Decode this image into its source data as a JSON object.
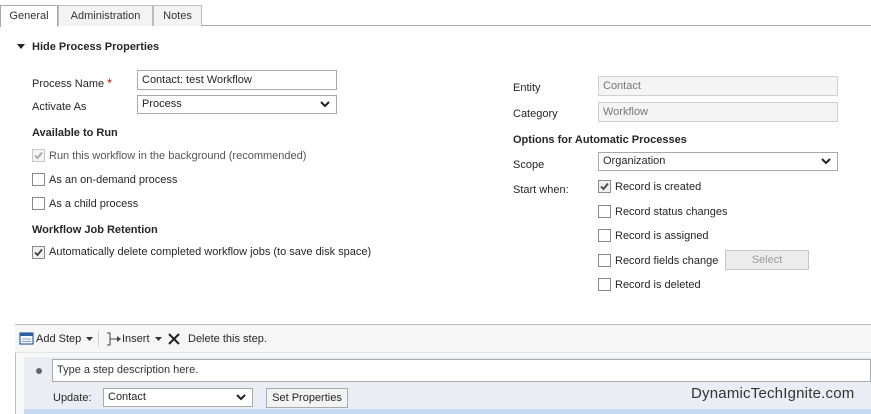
{
  "tabs": [
    {
      "label": "General",
      "active": true
    },
    {
      "label": "Administration",
      "active": false
    },
    {
      "label": "Notes",
      "active": false
    }
  ],
  "section": {
    "title": "Hide Process Properties"
  },
  "left": {
    "process_name_label": "Process Name",
    "required_marker": "*",
    "process_name_value": "Contact: test Workflow",
    "activate_as_label": "Activate As",
    "activate_as_value": "Process",
    "available_to_run_heading": "Available to Run",
    "options": [
      {
        "label": "Run this workflow in the background (recommended)",
        "checked": true,
        "disabled": true
      },
      {
        "label": "As an on-demand process",
        "checked": false,
        "disabled": false
      },
      {
        "label": "As a child process",
        "checked": false,
        "disabled": false
      }
    ],
    "retention_heading": "Workflow Job Retention",
    "retention_option": {
      "label": "Automatically delete completed workflow jobs (to save disk space)",
      "checked": true
    }
  },
  "right": {
    "entity_label": "Entity",
    "entity_value": "Contact",
    "category_label": "Category",
    "category_value": "Workflow",
    "options_heading": "Options for Automatic Processes",
    "scope_label": "Scope",
    "scope_value": "Organization",
    "start_when_label": "Start when:",
    "start_options": [
      {
        "label": "Record is created",
        "checked": true
      },
      {
        "label": "Record status changes",
        "checked": false
      },
      {
        "label": "Record is assigned",
        "checked": false
      },
      {
        "label": "Record fields change",
        "checked": false
      },
      {
        "label": "Record is deleted",
        "checked": false
      }
    ],
    "select_button_label": "Select"
  },
  "steps": {
    "add_step_label": "Add Step",
    "insert_label": "Insert",
    "delete_label": "Delete this step.",
    "description_placeholder": "Type a step description here.",
    "update_label": "Update:",
    "update_value": "Contact",
    "set_properties_label": "Set Properties"
  },
  "watermark": "DynamicTechIgnite.com"
}
